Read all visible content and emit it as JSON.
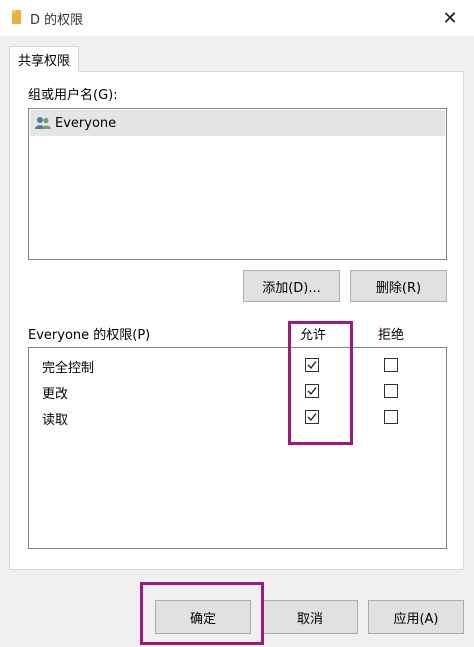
{
  "window": {
    "title": "D 的权限",
    "folder_icon": "folder-icon",
    "close_glyph": "✕"
  },
  "tabs": [
    {
      "label": "共享权限",
      "selected": true
    }
  ],
  "group_section": {
    "label": "组或用户名(G):",
    "users": [
      {
        "name": "Everyone",
        "icon": "users-icon",
        "selected": true
      }
    ],
    "add_label": "添加(D)...",
    "remove_label": "删除(R)"
  },
  "permissions": {
    "label": "Everyone 的权限(P)",
    "allow_header": "允许",
    "deny_header": "拒绝",
    "rows": [
      {
        "name": "完全控制",
        "allow": true,
        "deny": false
      },
      {
        "name": "更改",
        "allow": true,
        "deny": false
      },
      {
        "name": "读取",
        "allow": true,
        "deny": false
      }
    ]
  },
  "footer": {
    "ok_label": "确定",
    "cancel_label": "取消",
    "apply_label": "应用(A)"
  },
  "colors": {
    "highlight": "#a0197f",
    "selection": "#e5e5e5",
    "dialog_bg": "#f0f0f0"
  }
}
